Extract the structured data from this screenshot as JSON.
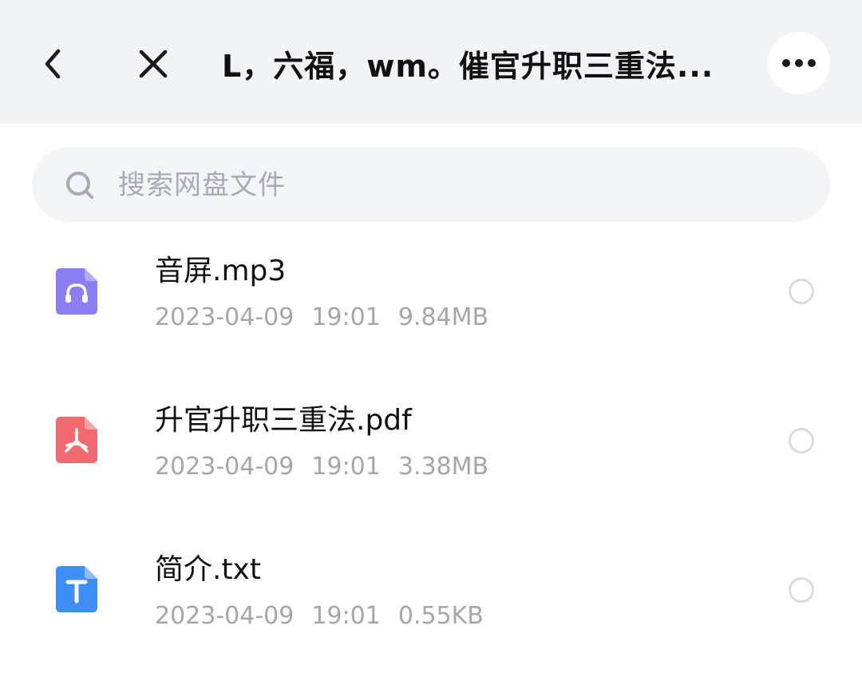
{
  "header": {
    "title": "L，六福，wm。催官升职三重法..."
  },
  "search": {
    "placeholder": "搜索网盘文件"
  },
  "files": [
    {
      "name": "音屏.mp3",
      "date": "2023-04-09",
      "time": "19:01",
      "size": "9.84MB",
      "icon": "audio-file-icon",
      "icon_color": "#8b7df2"
    },
    {
      "name": "升官升职三重法.pdf",
      "date": "2023-04-09",
      "time": "19:01",
      "size": "3.38MB",
      "icon": "pdf-file-icon",
      "icon_color": "#f26a6f"
    },
    {
      "name": "简介.txt",
      "date": "2023-04-09",
      "time": "19:01",
      "size": "0.55KB",
      "icon": "txt-file-icon",
      "icon_color": "#3d8ef7"
    }
  ]
}
